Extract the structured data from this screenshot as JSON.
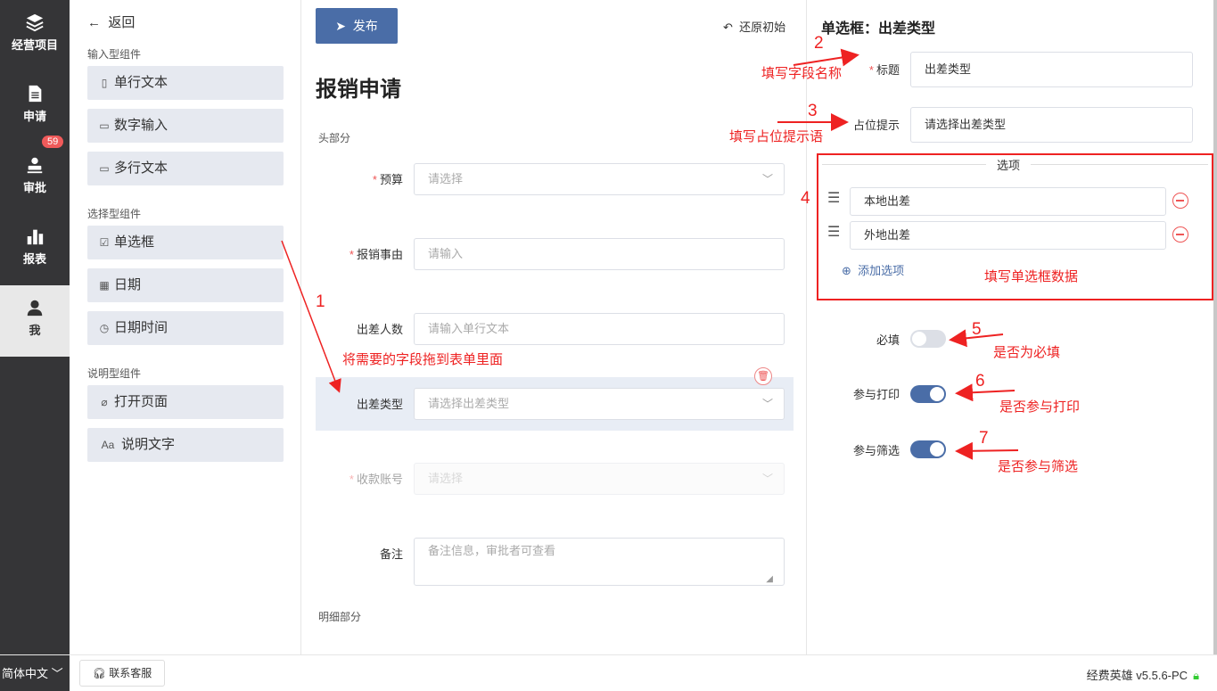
{
  "nav": {
    "items": [
      {
        "label": "经营项目",
        "icon": "layers-icon"
      },
      {
        "label": "申请",
        "icon": "document-icon"
      },
      {
        "label": "审批",
        "icon": "stamp-icon",
        "badge": "59"
      },
      {
        "label": "报表",
        "icon": "bar-chart-icon"
      },
      {
        "label": "我",
        "icon": "user-icon"
      }
    ]
  },
  "components": {
    "back": "返回",
    "groups": [
      {
        "title": "输入型组件",
        "items": [
          "单行文本",
          "数字输入",
          "多行文本"
        ]
      },
      {
        "title": "选择型组件",
        "items": [
          "单选框",
          "日期",
          "日期时间"
        ]
      },
      {
        "title": "说明型组件",
        "items": [
          "打开页面",
          "说明文字"
        ]
      }
    ],
    "icon_glyphs": [
      "▯",
      "▭",
      "▭",
      "☑",
      "▦",
      "◷",
      "🔗︎",
      "Aa"
    ]
  },
  "form": {
    "publish": "发布",
    "restore": "还原初始",
    "title": "报销申请",
    "head_section": "头部分",
    "detail_section": "明细部分",
    "fields": [
      {
        "label": "预算",
        "required": "*",
        "placeholder": "请选择",
        "type": "select"
      },
      {
        "label": "报销事由",
        "required": "*",
        "placeholder": "请输入",
        "type": "input"
      },
      {
        "label": "出差人数",
        "required": "",
        "placeholder": "请输入单行文本",
        "type": "input"
      },
      {
        "label": "出差类型",
        "required": "",
        "placeholder": "请选择出差类型",
        "type": "select"
      },
      {
        "label": "收款账号",
        "required": "*",
        "placeholder": "请选择",
        "type": "select"
      },
      {
        "label": "备注",
        "required": "",
        "placeholder": "备注信息，审批者可查看",
        "type": "textarea"
      }
    ]
  },
  "props": {
    "title": "单选框：出差类型",
    "title_label": "标题",
    "title_value": "出差类型",
    "placeholder_label": "占位提示",
    "placeholder_value": "请选择出差类型",
    "options_title": "选项",
    "options": [
      "本地出差",
      "外地出差"
    ],
    "add_option": "添加选项",
    "required_label": "必填",
    "required_on": false,
    "print_label": "参与打印",
    "print_on": true,
    "filter_label": "参与筛选",
    "filter_on": true
  },
  "bottom": {
    "language": "简体中文",
    "support": "联系客服",
    "version": "经费英雄 v5.5.6-PC"
  },
  "annotations": {
    "n1": "1",
    "t1": "将需要的字段拖到表单里面",
    "n2": "2",
    "t2": "填写字段名称",
    "n3": "3",
    "t3": "填写占位提示语",
    "n4": "4",
    "t4": "填写单选框数据",
    "n5": "5",
    "t5": "是否为必填",
    "n6": "6",
    "t6": "是否参与打印",
    "n7": "7",
    "t7": "是否参与筛选"
  },
  "colors": {
    "nav_bg": "#353537",
    "accent": "#4a6da7",
    "annotation": "#e22222",
    "highlight": "#e8edf5"
  }
}
